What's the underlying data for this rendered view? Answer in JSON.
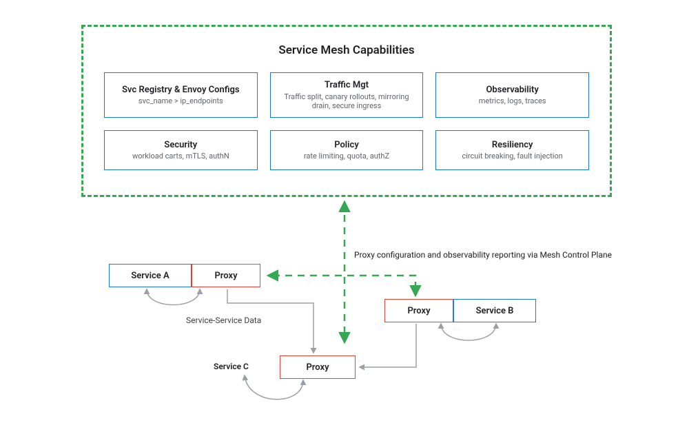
{
  "mesh": {
    "title": "Service Mesh Capabilities",
    "capabilities": [
      {
        "title": "Svc Registry & Envoy Configs",
        "sub": "svc_name >  ip_endpoints"
      },
      {
        "title": "Traffic Mgt",
        "sub": "Traffic split, canary rollouts, mirroring drain, secure ingress"
      },
      {
        "title": "Observability",
        "sub": "metrics, logs, traces"
      },
      {
        "title": "Security",
        "sub": "workload carts, mTLS, authN"
      },
      {
        "title": "Policy",
        "sub": "rate limiting, quota, authZ"
      },
      {
        "title": "Resiliency",
        "sub": "circuit breaking, fault injection"
      }
    ]
  },
  "nodes": {
    "serviceA": "Service A",
    "proxyA": "Proxy",
    "serviceB": "Service B",
    "proxyB": "Proxy",
    "proxyC": "Proxy",
    "serviceC_label": "Service C"
  },
  "labels": {
    "config": "Proxy configuration and observability reporting via Mesh Control Plane",
    "data": "Service-Service Data"
  },
  "colors": {
    "green": "#34a853",
    "blue": "#1a73e8",
    "red": "#ea4335",
    "gray": "#9aa0a6",
    "text": "#202124"
  }
}
